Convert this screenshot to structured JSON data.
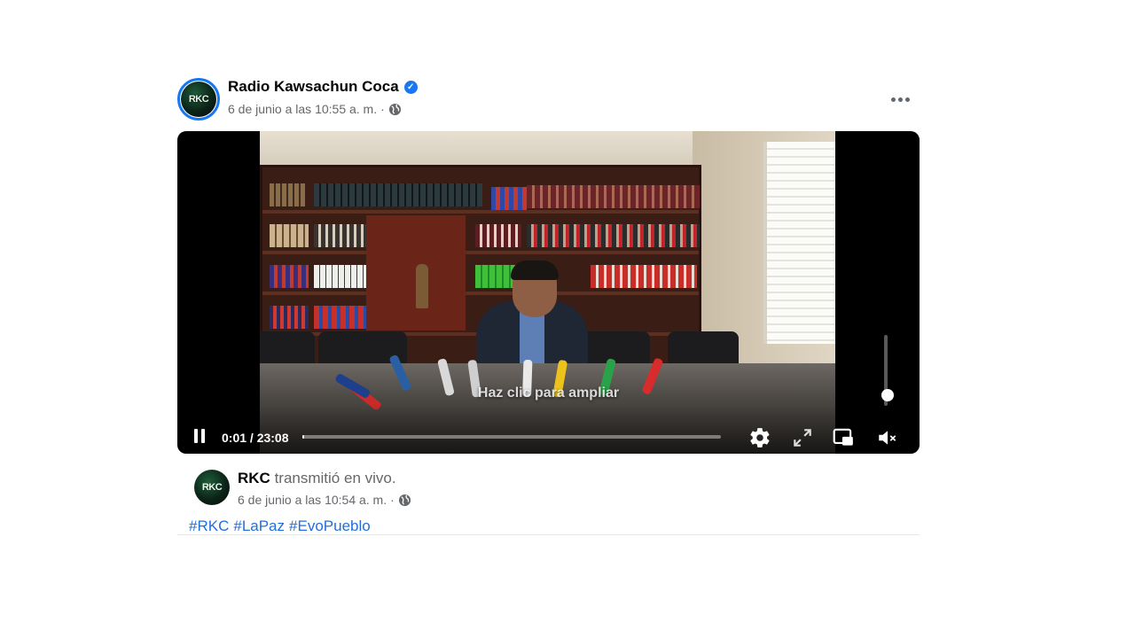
{
  "post": {
    "page_name": "Radio Kawsachun Coca",
    "verified": true,
    "timestamp": "6 de junio a las 10:55 a. m.",
    "separator": "·",
    "avatar_text": "RKC",
    "privacy_icon": "globe-icon",
    "more_icon": "more-options-icon"
  },
  "video": {
    "hint": "Haz clic para ampliar",
    "time": "0:01 / 23:08",
    "progress_fraction": 0.001,
    "volume_level": 0.15,
    "controls": [
      "pause-icon",
      "settings-icon",
      "fullscreen-icon",
      "picture-in-picture-icon",
      "muted-volume-icon"
    ]
  },
  "live": {
    "avatar_text": "RKC",
    "name": "RKC",
    "action": "transmitió en vivo.",
    "timestamp": "6 de junio a las 10:54 a. m.",
    "separator": "·",
    "privacy_icon": "globe-icon"
  },
  "hashtags": [
    "#RKC",
    "#LaPaz",
    "#EvoPueblo"
  ],
  "colors": {
    "accent": "#1877f2",
    "link": "#216fdb",
    "secondary_text": "#65676b"
  }
}
